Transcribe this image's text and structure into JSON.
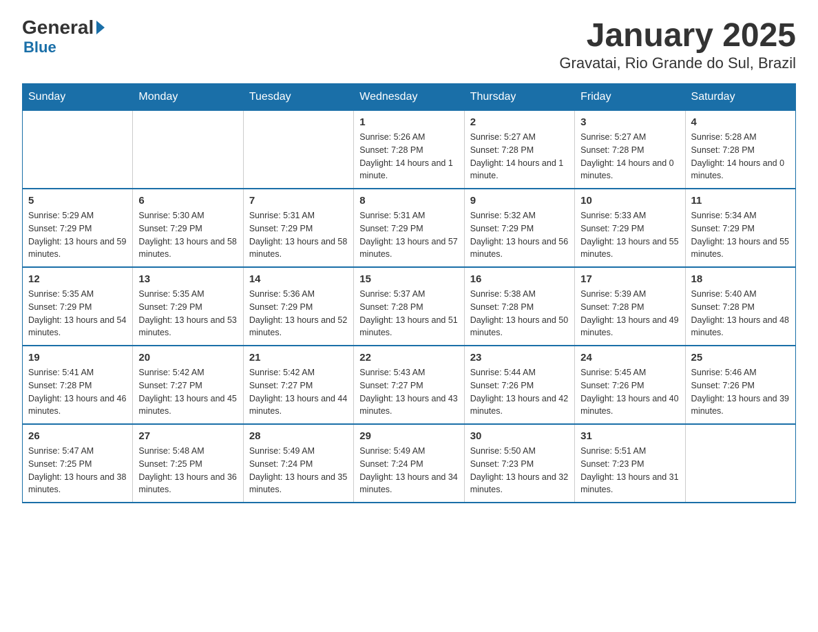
{
  "header": {
    "logo_general": "General",
    "logo_blue": "Blue",
    "month_title": "January 2025",
    "location": "Gravatai, Rio Grande do Sul, Brazil"
  },
  "days_of_week": [
    "Sunday",
    "Monday",
    "Tuesday",
    "Wednesday",
    "Thursday",
    "Friday",
    "Saturday"
  ],
  "weeks": [
    [
      {
        "day": "",
        "info": ""
      },
      {
        "day": "",
        "info": ""
      },
      {
        "day": "",
        "info": ""
      },
      {
        "day": "1",
        "info": "Sunrise: 5:26 AM\nSunset: 7:28 PM\nDaylight: 14 hours and 1 minute."
      },
      {
        "day": "2",
        "info": "Sunrise: 5:27 AM\nSunset: 7:28 PM\nDaylight: 14 hours and 1 minute."
      },
      {
        "day": "3",
        "info": "Sunrise: 5:27 AM\nSunset: 7:28 PM\nDaylight: 14 hours and 0 minutes."
      },
      {
        "day": "4",
        "info": "Sunrise: 5:28 AM\nSunset: 7:28 PM\nDaylight: 14 hours and 0 minutes."
      }
    ],
    [
      {
        "day": "5",
        "info": "Sunrise: 5:29 AM\nSunset: 7:29 PM\nDaylight: 13 hours and 59 minutes."
      },
      {
        "day": "6",
        "info": "Sunrise: 5:30 AM\nSunset: 7:29 PM\nDaylight: 13 hours and 58 minutes."
      },
      {
        "day": "7",
        "info": "Sunrise: 5:31 AM\nSunset: 7:29 PM\nDaylight: 13 hours and 58 minutes."
      },
      {
        "day": "8",
        "info": "Sunrise: 5:31 AM\nSunset: 7:29 PM\nDaylight: 13 hours and 57 minutes."
      },
      {
        "day": "9",
        "info": "Sunrise: 5:32 AM\nSunset: 7:29 PM\nDaylight: 13 hours and 56 minutes."
      },
      {
        "day": "10",
        "info": "Sunrise: 5:33 AM\nSunset: 7:29 PM\nDaylight: 13 hours and 55 minutes."
      },
      {
        "day": "11",
        "info": "Sunrise: 5:34 AM\nSunset: 7:29 PM\nDaylight: 13 hours and 55 minutes."
      }
    ],
    [
      {
        "day": "12",
        "info": "Sunrise: 5:35 AM\nSunset: 7:29 PM\nDaylight: 13 hours and 54 minutes."
      },
      {
        "day": "13",
        "info": "Sunrise: 5:35 AM\nSunset: 7:29 PM\nDaylight: 13 hours and 53 minutes."
      },
      {
        "day": "14",
        "info": "Sunrise: 5:36 AM\nSunset: 7:29 PM\nDaylight: 13 hours and 52 minutes."
      },
      {
        "day": "15",
        "info": "Sunrise: 5:37 AM\nSunset: 7:28 PM\nDaylight: 13 hours and 51 minutes."
      },
      {
        "day": "16",
        "info": "Sunrise: 5:38 AM\nSunset: 7:28 PM\nDaylight: 13 hours and 50 minutes."
      },
      {
        "day": "17",
        "info": "Sunrise: 5:39 AM\nSunset: 7:28 PM\nDaylight: 13 hours and 49 minutes."
      },
      {
        "day": "18",
        "info": "Sunrise: 5:40 AM\nSunset: 7:28 PM\nDaylight: 13 hours and 48 minutes."
      }
    ],
    [
      {
        "day": "19",
        "info": "Sunrise: 5:41 AM\nSunset: 7:28 PM\nDaylight: 13 hours and 46 minutes."
      },
      {
        "day": "20",
        "info": "Sunrise: 5:42 AM\nSunset: 7:27 PM\nDaylight: 13 hours and 45 minutes."
      },
      {
        "day": "21",
        "info": "Sunrise: 5:42 AM\nSunset: 7:27 PM\nDaylight: 13 hours and 44 minutes."
      },
      {
        "day": "22",
        "info": "Sunrise: 5:43 AM\nSunset: 7:27 PM\nDaylight: 13 hours and 43 minutes."
      },
      {
        "day": "23",
        "info": "Sunrise: 5:44 AM\nSunset: 7:26 PM\nDaylight: 13 hours and 42 minutes."
      },
      {
        "day": "24",
        "info": "Sunrise: 5:45 AM\nSunset: 7:26 PM\nDaylight: 13 hours and 40 minutes."
      },
      {
        "day": "25",
        "info": "Sunrise: 5:46 AM\nSunset: 7:26 PM\nDaylight: 13 hours and 39 minutes."
      }
    ],
    [
      {
        "day": "26",
        "info": "Sunrise: 5:47 AM\nSunset: 7:25 PM\nDaylight: 13 hours and 38 minutes."
      },
      {
        "day": "27",
        "info": "Sunrise: 5:48 AM\nSunset: 7:25 PM\nDaylight: 13 hours and 36 minutes."
      },
      {
        "day": "28",
        "info": "Sunrise: 5:49 AM\nSunset: 7:24 PM\nDaylight: 13 hours and 35 minutes."
      },
      {
        "day": "29",
        "info": "Sunrise: 5:49 AM\nSunset: 7:24 PM\nDaylight: 13 hours and 34 minutes."
      },
      {
        "day": "30",
        "info": "Sunrise: 5:50 AM\nSunset: 7:23 PM\nDaylight: 13 hours and 32 minutes."
      },
      {
        "day": "31",
        "info": "Sunrise: 5:51 AM\nSunset: 7:23 PM\nDaylight: 13 hours and 31 minutes."
      },
      {
        "day": "",
        "info": ""
      }
    ]
  ]
}
